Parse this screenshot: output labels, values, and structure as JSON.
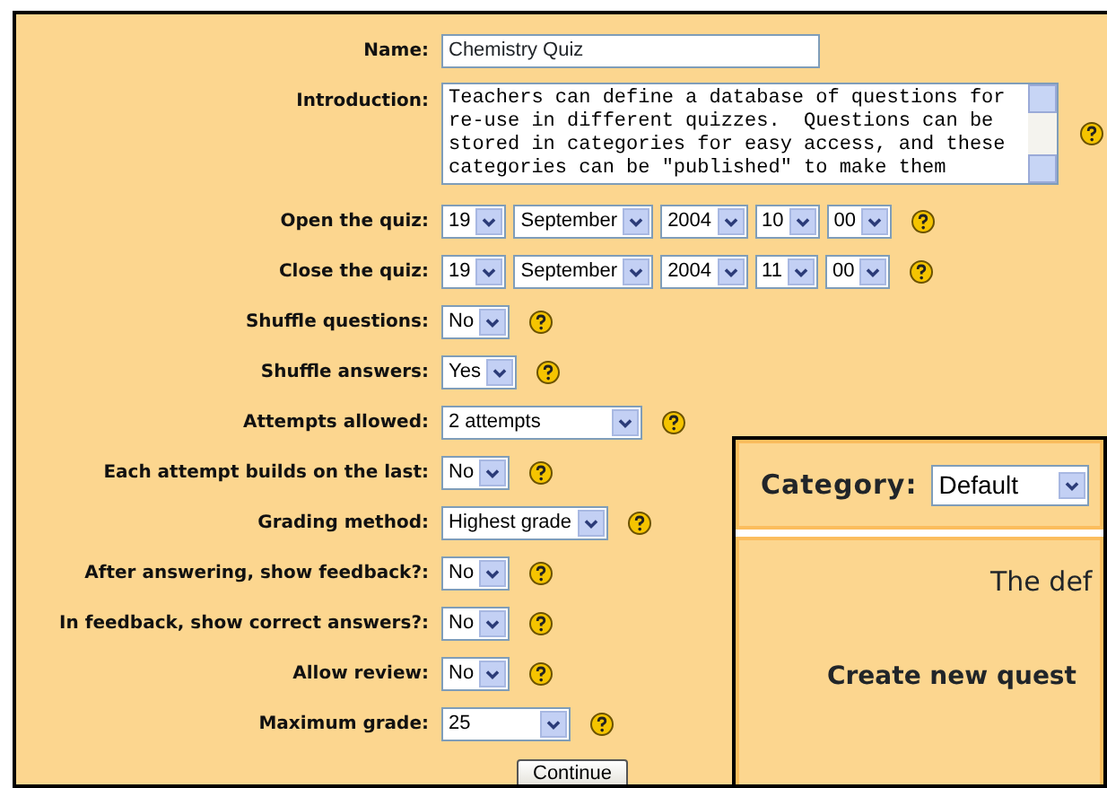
{
  "fields": [
    {
      "kind": "text",
      "label": "Name:",
      "value": "Chemistry Quiz",
      "help": false
    },
    {
      "kind": "textarea",
      "label": "Introduction:",
      "value": "Teachers can define a database of questions for re-use in different quizzes.  Questions can be stored in categories for easy access, and these categories can be \"published\" to make them",
      "help": true
    },
    {
      "kind": "datetime",
      "label": "Open the quiz:",
      "parts": [
        "19",
        "September",
        "2004",
        "10",
        "00"
      ],
      "help": true
    },
    {
      "kind": "datetime",
      "label": "Close the quiz:",
      "parts": [
        "19",
        "September",
        "2004",
        "11",
        "00"
      ],
      "help": true
    },
    {
      "kind": "select",
      "label": "Shuffle questions:",
      "value": "No",
      "help": true
    },
    {
      "kind": "select",
      "label": "Shuffle answers:",
      "value": "Yes",
      "help": true
    },
    {
      "kind": "select",
      "label": "Attempts allowed:",
      "value": "2 attempts",
      "help": true
    },
    {
      "kind": "select",
      "label": "Each attempt builds on the last:",
      "value": "No",
      "help": true
    },
    {
      "kind": "select",
      "label": "Grading method:",
      "value": "Highest grade",
      "help": true
    },
    {
      "kind": "select",
      "label": "After answering, show feedback?:",
      "value": "No",
      "help": true
    },
    {
      "kind": "select",
      "label": "In feedback, show correct answers?:",
      "value": "No",
      "help": true
    },
    {
      "kind": "select",
      "label": "Allow review:",
      "value": "No",
      "help": true
    },
    {
      "kind": "select",
      "label": "Maximum grade:",
      "value": "25",
      "help": true
    }
  ],
  "continue_button": "Continue",
  "category_panel": {
    "label": "Category:",
    "value": "Default",
    "notice": "The def",
    "link": "Create new quest"
  }
}
